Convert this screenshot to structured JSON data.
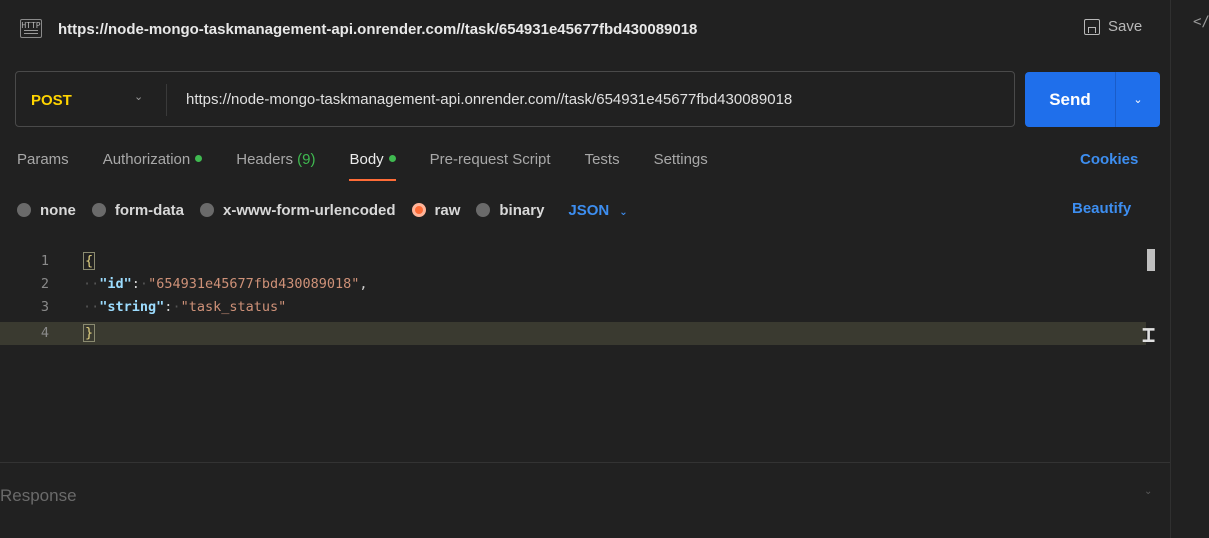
{
  "title": {
    "icon_text": "HTTP",
    "url": "https://node-mongo-taskmanagement-api.onrender.com//task/654931e45677fbd430089018",
    "save_label": "Save"
  },
  "request": {
    "method": "POST",
    "url": "https://node-mongo-taskmanagement-api.onrender.com//task/654931e45677fbd430089018",
    "send_label": "Send"
  },
  "tabs": [
    {
      "label": "Params"
    },
    {
      "label": "Authorization"
    },
    {
      "label": "Headers",
      "count": "(9)"
    },
    {
      "label": "Body"
    },
    {
      "label": "Pre-request Script"
    },
    {
      "label": "Tests"
    },
    {
      "label": "Settings"
    }
  ],
  "cookies_label": "Cookies",
  "body_types": [
    {
      "label": "none"
    },
    {
      "label": "form-data"
    },
    {
      "label": "x-www-form-urlencoded"
    },
    {
      "label": "raw"
    },
    {
      "label": "binary"
    }
  ],
  "format_label": "JSON",
  "beautify_label": "Beautify",
  "editor": {
    "line_numbers": [
      "1",
      "2",
      "3",
      "4"
    ],
    "open_brace": "{",
    "close_brace": "}",
    "key1": "\"id\"",
    "val1": "\"654931e45677fbd430089018\"",
    "key2": "\"string\"",
    "val2": "\"task_status\""
  },
  "response_label": "Response",
  "colors": {
    "background": "#212121",
    "method": "#ffd400",
    "send_button": "#1f6feb",
    "active_tab_underline": "#ff6c37",
    "status_dot": "#3fb950",
    "link": "#3d8ef0"
  }
}
